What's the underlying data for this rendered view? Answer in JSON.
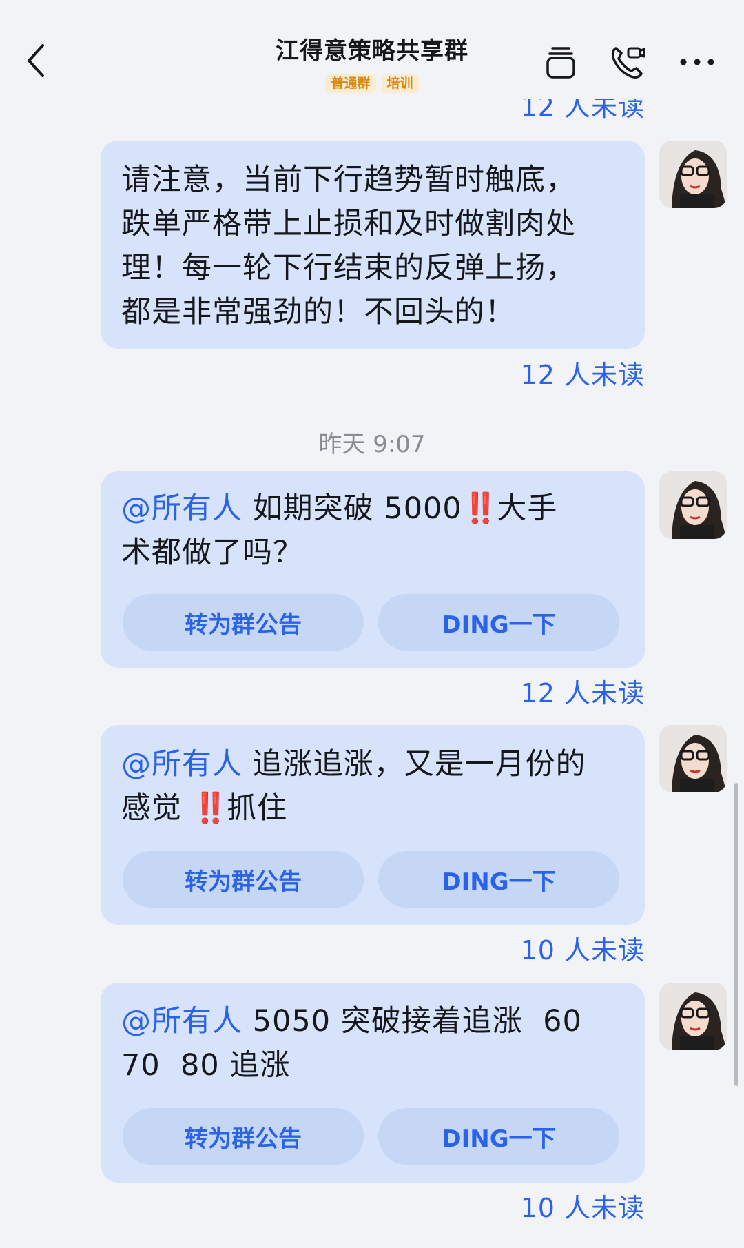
{
  "header": {
    "title": "江得意策略共享群",
    "tags": [
      "普通群",
      "培训"
    ]
  },
  "messages": [
    {
      "text": "请注意，当前下行趋势暂时触底，\n跌单严格带上止损和及时做割肉处\n理！每一轮下行结束的反弹上扬，\n都是非常强劲的！不回头的！",
      "unread": "12 人未读"
    },
    {
      "mention": "@所有人",
      "before": " 如期突破 5000",
      "bang": "‼️",
      "after": "大手\n术都做了吗？",
      "unread": "12 人未读"
    },
    {
      "mention": "@所有人",
      "before": " 追涨追涨，又是一月份的\n感觉 ",
      "bang": "‼️",
      "after": "抓住",
      "unread": "10 人未读"
    },
    {
      "mention": "@所有人",
      "before": " 5050 突破接着追涨  60\n70  80 追涨",
      "bang": "",
      "after": "",
      "unread": "10 人未读"
    }
  ],
  "top_unread": "12 人未读",
  "timestamp": "昨天 9:07",
  "buttons": {
    "announce": "转为群公告",
    "ding": "DING一下"
  },
  "colors": {
    "accent": "#2a63e8",
    "bubble": "#d6e3fb",
    "background": "#f2f3f7",
    "tag": "#d98a14",
    "alert": "#e02a2a"
  }
}
